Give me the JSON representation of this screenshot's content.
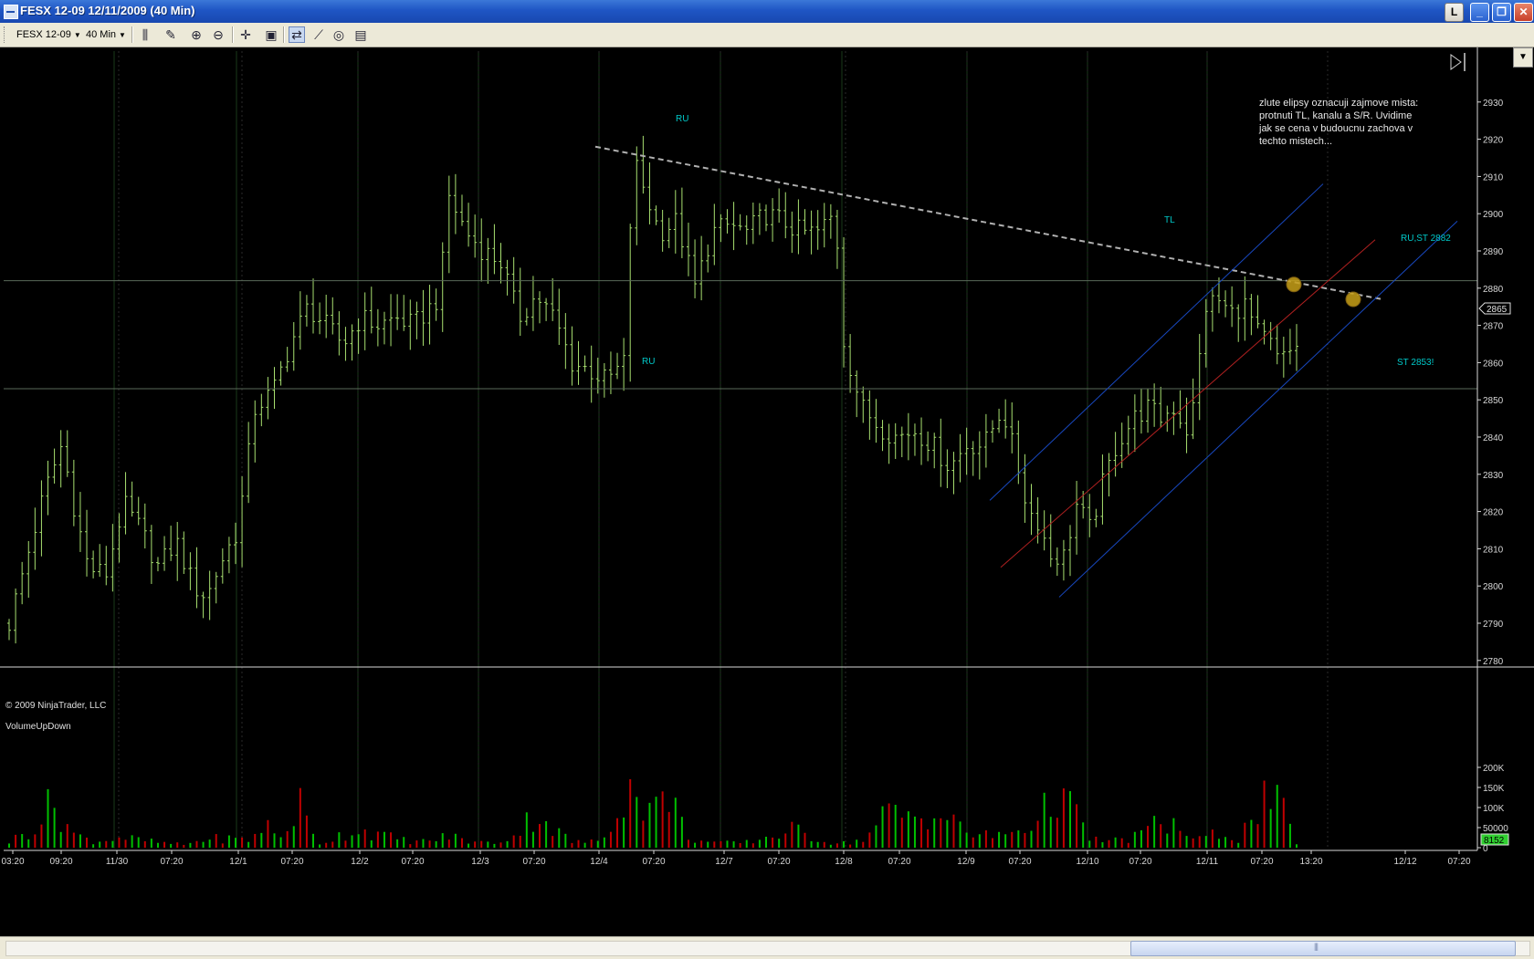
{
  "window": {
    "title": "FESX 12-09  12/11/2009 (40 Min)"
  },
  "title_buttons": {
    "l": "L",
    "min": "_",
    "max": "❐",
    "close": "✕"
  },
  "toolbar": {
    "instrument": "FESX 12-09",
    "interval": "40 Min"
  },
  "copyright": "© 2009 NinjaTrader, LLC",
  "volume_label": "VolumeUpDown",
  "last_price": "2865",
  "last_volume": "8152",
  "annotation_text": [
    "zlute elipsy oznacuji zajmove mista:",
    "protnuti TL, kanalu a S/R. Uvidime",
    "jak se cena v budoucnu zachova v",
    "techto mistech..."
  ],
  "labels": {
    "ru_top": "RU",
    "ru_bottom": "RU",
    "tl": "TL",
    "ru_st": "RU,ST 2882",
    "st": "ST 2853!"
  },
  "colors": {
    "up": "#00c000",
    "down": "#c00000",
    "bar": "#a8e070",
    "label": "#00c8c8",
    "channel": "#1848c0",
    "midline": "#b02020",
    "trendline": "#b0b0b0",
    "ellipse": "#c8a018"
  },
  "chart_data": {
    "type": "ohlc",
    "instrument": "FESX 12-09",
    "interval": "40 Min",
    "price_axis": {
      "ticks": [
        2780,
        2790,
        2800,
        2810,
        2820,
        2830,
        2840,
        2850,
        2860,
        2870,
        2880,
        2890,
        2900,
        2910,
        2920,
        2930
      ]
    },
    "volume_axis": {
      "ticks": [
        "0",
        "50000",
        "100K",
        "150K",
        "200K"
      ],
      "ticks_values": [
        0,
        50000,
        100000,
        150000,
        200000
      ]
    },
    "time_axis": {
      "ticks": [
        "03:20",
        "09:20",
        "11/30",
        "07:20",
        "12/1",
        "07:20",
        "12/2",
        "07:20",
        "12/3",
        "07:20",
        "12/4",
        "07:20",
        "12/7",
        "07:20",
        "12/8",
        "07:20",
        "12/9",
        "07:20",
        "12/10",
        "07:20",
        "12/11",
        "07:20",
        "13:20",
        "12/12",
        "07:20"
      ]
    },
    "horizontal_levels": [
      2882,
      2853
    ],
    "bar_count": 200,
    "anchors": [
      [
        0,
        2790
      ],
      [
        8,
        2825
      ],
      [
        12,
        2838
      ],
      [
        15,
        2820
      ],
      [
        18,
        2805
      ],
      [
        22,
        2803
      ],
      [
        26,
        2822
      ],
      [
        30,
        2815
      ],
      [
        34,
        2805
      ],
      [
        38,
        2812
      ],
      [
        42,
        2800
      ],
      [
        45,
        2797
      ],
      [
        48,
        2806
      ],
      [
        52,
        2815
      ],
      [
        56,
        2848
      ],
      [
        60,
        2852
      ],
      [
        64,
        2865
      ],
      [
        68,
        2875
      ],
      [
        72,
        2870
      ],
      [
        76,
        2865
      ],
      [
        80,
        2872
      ],
      [
        84,
        2870
      ],
      [
        88,
        2872
      ],
      [
        92,
        2870
      ],
      [
        96,
        2875
      ],
      [
        98,
        2878
      ],
      [
        100,
        2905
      ],
      [
        104,
        2895
      ],
      [
        108,
        2890
      ],
      [
        112,
        2887
      ],
      [
        116,
        2872
      ],
      [
        120,
        2878
      ],
      [
        124,
        2872
      ],
      [
        128,
        2860
      ],
      [
        132,
        2858
      ],
      [
        136,
        2855
      ],
      [
        140,
        2860
      ],
      [
        142,
        2915
      ],
      [
        145,
        2905
      ],
      [
        148,
        2895
      ],
      [
        152,
        2898
      ],
      [
        156,
        2880
      ],
      [
        160,
        2895
      ],
      [
        164,
        2897
      ],
      [
        168,
        2895
      ],
      [
        172,
        2900
      ],
      [
        176,
        2898
      ],
      [
        180,
        2895
      ],
      [
        184,
        2895
      ],
      [
        188,
        2900
      ],
      [
        190,
        2865
      ],
      [
        194,
        2848
      ],
      [
        198,
        2843
      ],
      [
        202,
        2840
      ],
      [
        206,
        2842
      ],
      [
        210,
        2838
      ],
      [
        214,
        2832
      ],
      [
        218,
        2838
      ],
      [
        222,
        2838
      ],
      [
        226,
        2848
      ],
      [
        230,
        2830
      ],
      [
        232,
        2820
      ],
      [
        234,
        2818
      ],
      [
        237,
        2808
      ],
      [
        240,
        2808
      ],
      [
        243,
        2822
      ],
      [
        246,
        2815
      ],
      [
        249,
        2828
      ],
      [
        252,
        2838
      ],
      [
        256,
        2845
      ],
      [
        259,
        2848
      ],
      [
        262,
        2845
      ],
      [
        265,
        2848
      ],
      [
        268,
        2842
      ],
      [
        270,
        2850
      ],
      [
        272,
        2875
      ],
      [
        275,
        2877
      ],
      [
        278,
        2873
      ],
      [
        281,
        2876
      ],
      [
        284,
        2868
      ],
      [
        287,
        2865
      ],
      [
        289,
        2860
      ],
      [
        291,
        2862
      ],
      [
        293,
        2865
      ]
    ],
    "volume_anchors": [
      [
        0,
        20
      ],
      [
        5,
        60
      ],
      [
        10,
        150
      ],
      [
        15,
        40
      ],
      [
        20,
        20
      ],
      [
        25,
        35
      ],
      [
        30,
        25
      ],
      [
        35,
        15
      ],
      [
        40,
        10
      ],
      [
        45,
        30
      ],
      [
        50,
        30
      ],
      [
        55,
        25
      ],
      [
        58,
        80
      ],
      [
        62,
        30
      ],
      [
        66,
        150
      ],
      [
        70,
        10
      ],
      [
        75,
        40
      ],
      [
        80,
        60
      ],
      [
        85,
        40
      ],
      [
        90,
        25
      ],
      [
        95,
        20
      ],
      [
        100,
        40
      ],
      [
        105,
        20
      ],
      [
        110,
        15
      ],
      [
        115,
        40
      ],
      [
        120,
        120
      ],
      [
        124,
        60
      ],
      [
        128,
        20
      ],
      [
        132,
        18
      ],
      [
        135,
        25
      ],
      [
        140,
        200
      ],
      [
        144,
        160
      ],
      [
        147,
        120
      ],
      [
        150,
        200
      ],
      [
        154,
        40
      ],
      [
        158,
        20
      ],
      [
        162,
        15
      ],
      [
        168,
        18
      ],
      [
        174,
        40
      ],
      [
        178,
        60
      ],
      [
        182,
        40
      ],
      [
        186,
        20
      ],
      [
        190,
        15
      ],
      [
        195,
        30
      ],
      [
        200,
        120
      ],
      [
        205,
        100
      ],
      [
        210,
        120
      ],
      [
        215,
        80
      ],
      [
        220,
        40
      ],
      [
        225,
        40
      ],
      [
        230,
        60
      ],
      [
        235,
        100
      ],
      [
        238,
        210
      ],
      [
        242,
        120
      ],
      [
        246,
        30
      ],
      [
        250,
        20
      ],
      [
        255,
        30
      ],
      [
        260,
        70
      ],
      [
        265,
        80
      ],
      [
        270,
        20
      ],
      [
        275,
        50
      ],
      [
        280,
        30
      ],
      [
        285,
        150
      ],
      [
        289,
        140
      ],
      [
        293,
        20
      ]
    ],
    "volume_up_down": [
      1,
      0,
      1,
      1,
      0,
      0,
      1,
      1,
      1,
      0,
      0,
      1,
      0,
      1,
      1,
      0,
      1,
      0,
      0,
      1,
      1,
      0,
      1,
      1,
      0,
      1,
      0,
      0,
      1,
      0,
      1,
      1,
      0,
      0,
      1,
      1,
      0,
      1,
      0,
      1,
      0,
      1,
      1,
      0,
      1,
      0,
      0,
      1,
      1,
      0,
      0,
      1,
      0,
      1,
      1,
      0,
      1,
      0,
      1,
      0,
      1,
      1,
      0,
      0,
      1,
      0,
      1,
      1,
      0,
      1,
      0,
      1,
      0,
      0,
      1,
      1,
      0,
      1,
      0,
      0,
      1,
      1,
      0,
      1,
      0,
      1,
      1,
      0,
      0,
      1,
      0,
      1,
      1,
      0,
      0,
      1,
      0,
      1,
      0,
      1,
      1,
      0,
      0,
      1,
      1,
      0,
      1,
      0,
      1,
      0,
      0,
      1,
      1,
      0,
      1,
      0,
      1,
      1,
      0,
      1,
      0,
      0,
      1,
      0,
      1,
      1,
      0,
      1,
      0,
      1,
      0,
      1,
      0,
      0,
      1,
      1,
      0,
      1,
      0,
      1,
      1,
      0,
      0,
      1,
      0,
      1,
      0,
      1,
      1,
      0,
      1,
      0,
      0,
      1,
      1,
      0,
      1,
      0,
      1,
      0,
      1,
      1,
      0,
      0,
      1,
      0,
      1,
      1,
      0,
      1,
      0,
      1,
      0,
      0,
      1,
      1,
      0,
      1,
      0,
      1,
      1,
      0,
      1,
      0,
      0,
      1,
      0,
      1,
      1,
      0,
      1,
      0,
      1,
      0,
      0,
      1,
      1,
      0,
      1,
      1,
      0,
      1,
      0,
      0,
      1,
      1,
      0,
      1,
      0,
      1,
      1,
      0,
      1,
      0,
      1,
      0,
      1,
      1,
      0,
      0,
      1,
      1,
      0,
      1,
      0,
      1,
      0,
      0,
      1,
      1,
      0,
      1,
      1,
      0,
      0,
      1,
      1,
      0,
      1,
      0,
      1,
      0,
      1,
      1,
      0,
      0,
      1,
      0,
      1,
      0,
      1,
      1,
      0,
      1,
      0,
      0,
      1,
      1,
      0,
      1,
      1,
      0,
      0,
      1,
      0,
      1,
      0,
      1,
      1,
      0,
      1,
      0,
      1,
      0,
      1,
      1,
      0,
      0,
      1,
      0,
      1,
      0,
      1,
      1,
      0,
      1,
      0,
      0,
      1,
      1,
      0,
      1,
      0
    ]
  }
}
